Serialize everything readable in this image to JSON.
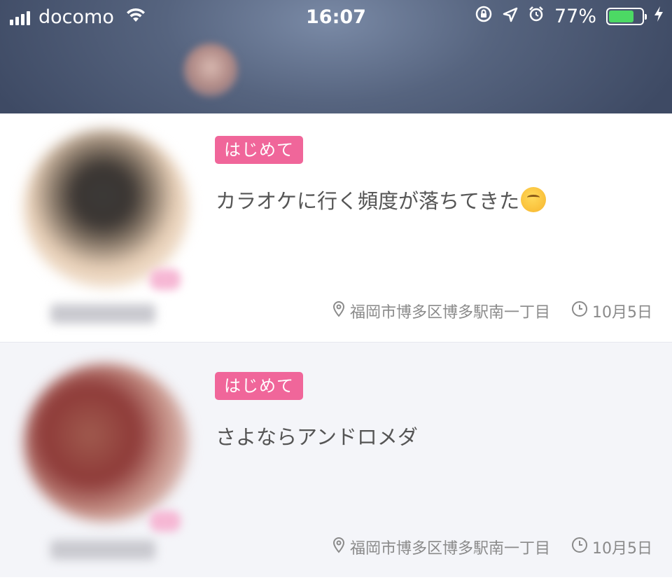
{
  "status_bar": {
    "carrier": "docomo",
    "time": "16:07",
    "battery_percent": "77%",
    "battery_level": 0.77,
    "battery_color": "#4cd964"
  },
  "header": {
    "background_color": "#4a5670"
  },
  "posts": [
    {
      "tag": "はじめて",
      "title": "カラオケに行く頻度が落ちてきた",
      "emoji": "thinking-face",
      "location": "福岡市博多区博多駅南一丁目",
      "date": "10月5日"
    },
    {
      "tag": "はじめて",
      "title": "さよならアンドロメダ",
      "location": "福岡市博多区博多駅南一丁目",
      "date": "10月5日"
    }
  ],
  "colors": {
    "tag_background": "#f0669a",
    "card_alt_background": "#f4f5f9",
    "meta_text": "#8a8a8a"
  }
}
